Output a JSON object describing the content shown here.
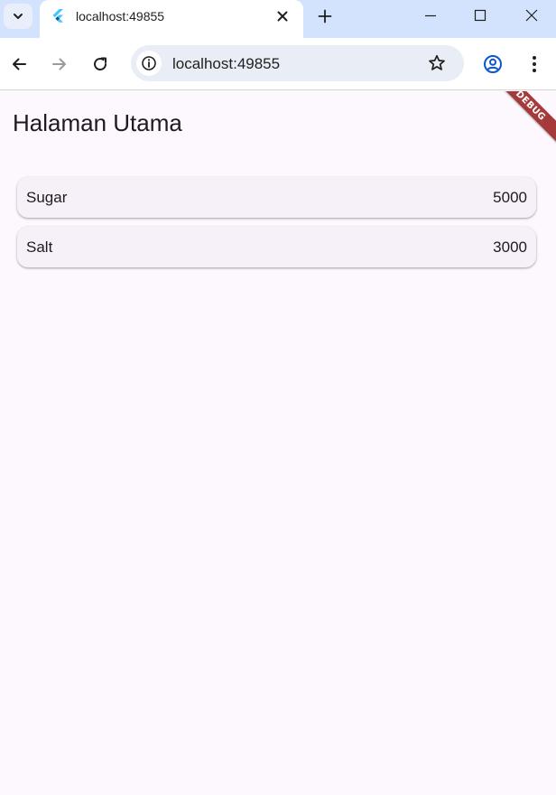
{
  "browser": {
    "tab": {
      "title": "localhost:49855",
      "favicon": "flutter-icon"
    },
    "omnibox": {
      "url": "localhost:49855"
    },
    "icons": {
      "tab_search": "chevron-down-icon",
      "tab_close": "close-icon",
      "new_tab": "plus-icon",
      "minimize": "minimize-icon",
      "maximize": "maximize-icon",
      "window_close": "close-icon",
      "back": "arrow-left-icon",
      "forward": "arrow-right-icon",
      "reload": "reload-icon",
      "site_info": "info-icon",
      "bookmark": "star-icon",
      "profile": "account-icon",
      "menu": "kebab-menu-icon"
    },
    "colors": {
      "tabstrip_bg": "#d3e3fd",
      "omnibox_bg": "#e9eef6",
      "profile_accent": "#0b57d0"
    }
  },
  "app": {
    "title": "Halaman Utama",
    "items": [
      {
        "name": "Sugar",
        "price": "5000"
      },
      {
        "name": "Salt",
        "price": "3000"
      }
    ],
    "debug_banner": "DEBUG",
    "colors": {
      "background": "#fdf7fe",
      "card_bg": "#f6f1f8",
      "debug_banner": "#a63a3a"
    }
  }
}
